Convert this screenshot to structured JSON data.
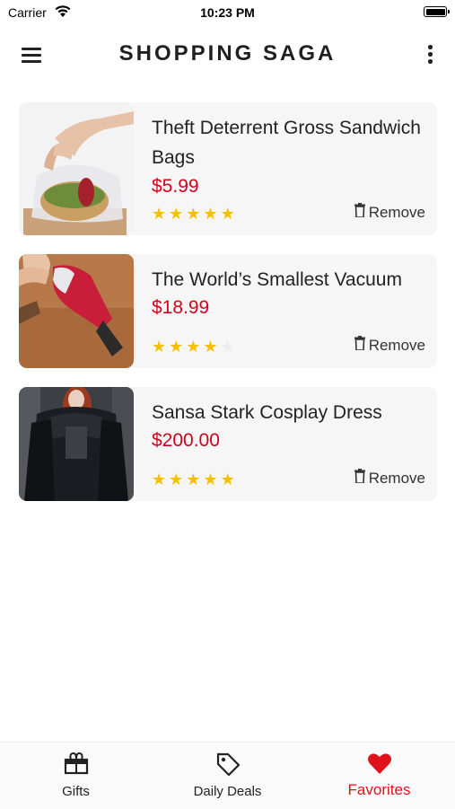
{
  "status_bar": {
    "carrier": "Carrier",
    "time": "10:23 PM"
  },
  "header": {
    "title": "SHOPPING SAGA",
    "menu_icon": "hamburger-menu-icon",
    "more_icon": "more-vertical-icon"
  },
  "items": [
    {
      "name": "Theft Deterrent Gross Sandwich Bags",
      "price": "$5.99",
      "rating": 5,
      "max_rating": 5,
      "remove_label": "Remove",
      "image": "sandwich-bag-photo"
    },
    {
      "name": "The World’s Smallest Vacuum",
      "price": "$18.99",
      "rating": 4,
      "max_rating": 5,
      "remove_label": "Remove",
      "image": "mini-vacuum-photo"
    },
    {
      "name": "Sansa Stark Cosplay Dress",
      "price": "$200.00",
      "rating": 5,
      "max_rating": 5,
      "remove_label": "Remove",
      "image": "cosplay-dress-photo"
    }
  ],
  "tabs": [
    {
      "label": "Gifts",
      "icon": "gift-icon",
      "active": false
    },
    {
      "label": "Daily Deals",
      "icon": "tag-icon",
      "active": false
    },
    {
      "label": "Favorites",
      "icon": "heart-icon",
      "active": true
    }
  ],
  "colors": {
    "accent": "#e0121c",
    "price": "#d0021b",
    "star": "#f5c000",
    "card_bg": "#f6f6f6"
  }
}
